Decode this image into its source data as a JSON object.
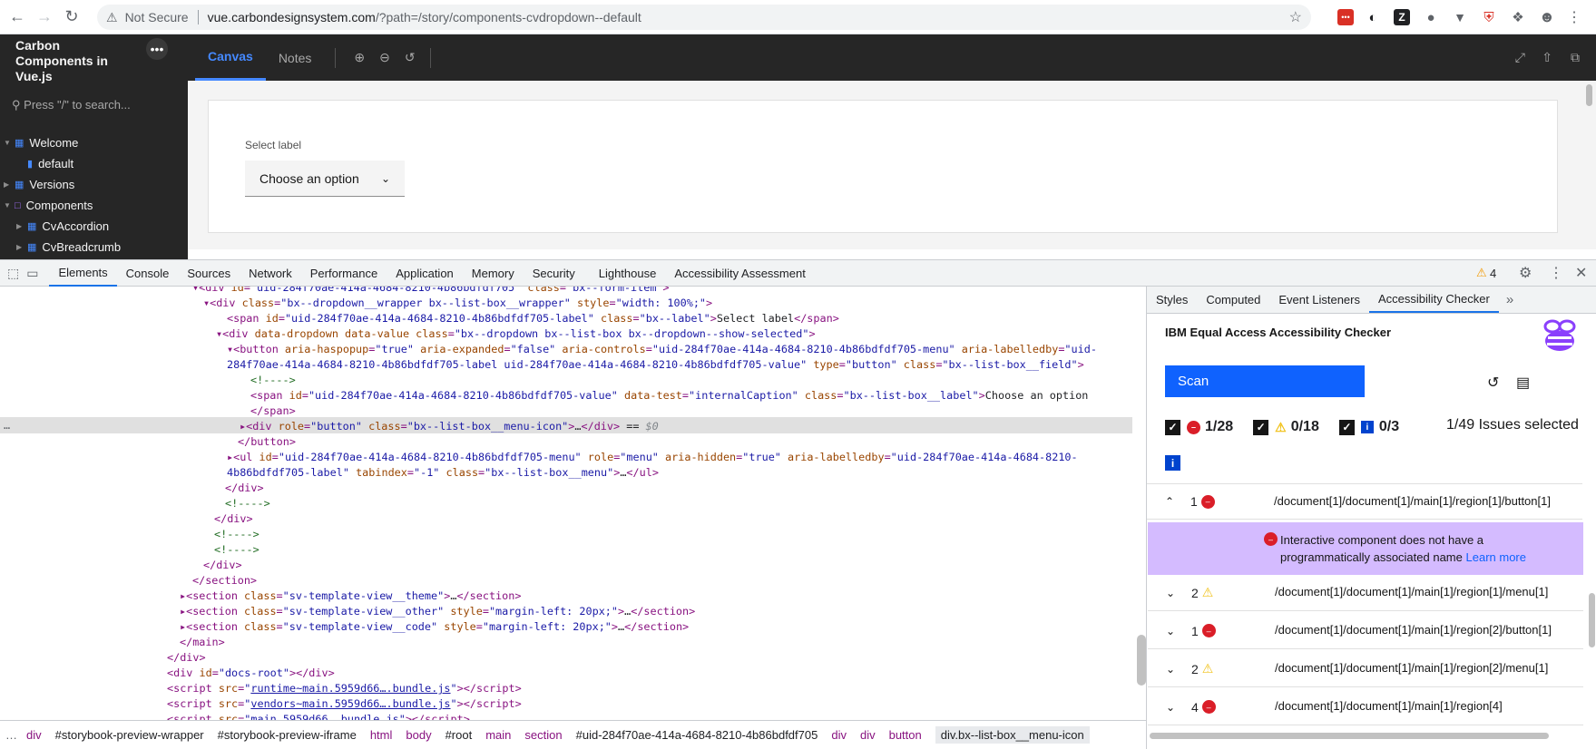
{
  "browser": {
    "security_label": "Not Secure",
    "url_host": "vue.carbondesignsystem.com",
    "url_rest": "/?path=/story/components-cvdropdown--default"
  },
  "storybook": {
    "title": "Carbon Components in Vue.js",
    "search_placeholder": "Press \"/\" to search...",
    "tree": [
      {
        "label": "Welcome"
      },
      {
        "label": "default"
      },
      {
        "label": "Versions"
      },
      {
        "label": "Components"
      },
      {
        "label": "CvAccordion"
      },
      {
        "label": "CvBreadcrumb"
      }
    ],
    "tabs": [
      "Canvas",
      "Notes"
    ],
    "preview": {
      "select_label": "Select label",
      "dropdown_value": "Choose an option"
    }
  },
  "devtools": {
    "tabs": [
      "Elements",
      "Console",
      "Sources",
      "Network",
      "Performance",
      "Application",
      "Memory",
      "Security",
      "Lighthouse",
      "Accessibility Assessment"
    ],
    "warning_count": "4",
    "breadcrumbs": [
      "div",
      "#storybook-preview-wrapper",
      "#storybook-preview-iframe",
      "html",
      "body",
      "#root",
      "main",
      "section",
      "#uid-284f70ae-414a-4684-8210-4b86bdfdf705",
      "div",
      "div",
      "button",
      "div.bx--list-box__menu-icon"
    ]
  },
  "side_panel": {
    "tabs": [
      "Styles",
      "Computed",
      "Event Listeners",
      "Accessibility Checker"
    ],
    "checker_title": "IBM Equal Access Accessibility Checker",
    "scan_label": "Scan",
    "filters": {
      "violations": "1/28",
      "potential": "0/18",
      "recommendations": "0/3"
    },
    "issues_selected": "1/49 Issues selected",
    "issues": [
      {
        "count": "1",
        "type": "violation",
        "path": "/document[1]/document[1]/main[1]/region[1]/button[1]",
        "expanded": true
      },
      {
        "count": "2",
        "type": "potential",
        "path": "/document[1]/document[1]/main[1]/region[1]/menu[1]"
      },
      {
        "count": "1",
        "type": "violation",
        "path": "/document[1]/document[1]/main[1]/region[2]/button[1]"
      },
      {
        "count": "2",
        "type": "potential",
        "path": "/document[1]/document[1]/main[1]/region[2]/menu[1]"
      },
      {
        "count": "4",
        "type": "violation",
        "path": "/document[1]/document[1]/main[1]/region[4]"
      }
    ],
    "expanded_message": "Interactive component does not have a programmatically associated name",
    "learn_more": "Learn more"
  },
  "colors": {
    "accent": "#1a73e8",
    "carbon_blue": "#0f62fe",
    "violation": "#da1e28",
    "highlight": "#d4bbff"
  }
}
